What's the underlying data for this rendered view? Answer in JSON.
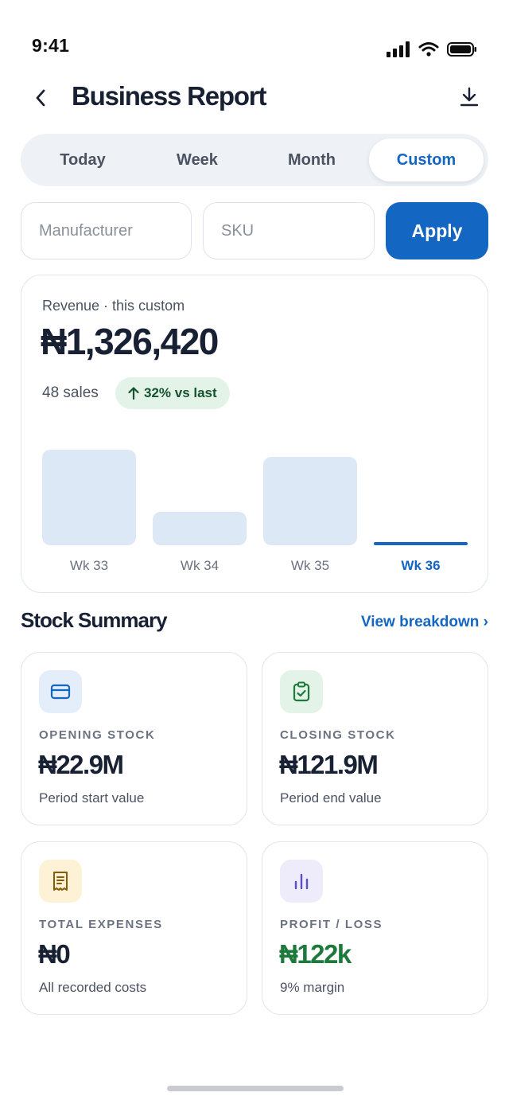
{
  "status_bar": {
    "time": "9:41"
  },
  "header": {
    "title": "Business Report"
  },
  "tabs": [
    {
      "label": "Today",
      "active": false
    },
    {
      "label": "Week",
      "active": false
    },
    {
      "label": "Month",
      "active": false
    },
    {
      "label": "Custom",
      "active": true
    }
  ],
  "filters": {
    "manufacturer_placeholder": "Manufacturer",
    "manufacturer_value": "",
    "sku_placeholder": "SKU",
    "sku_value": "",
    "apply_label": "Apply"
  },
  "revenue": {
    "label": "Revenue · this custom",
    "amount": "₦1,326,420",
    "sales": "48 sales",
    "growth": "32% vs last"
  },
  "chart_data": {
    "type": "bar",
    "categories": [
      "Wk 33",
      "Wk 34",
      "Wk 35",
      "Wk 36"
    ],
    "values": [
      0.91,
      0.32,
      0.84,
      0.03
    ],
    "highlight": "Wk 36",
    "colors": {
      "bar": "#dde8f6",
      "highlight": "#1466c3"
    },
    "title": "",
    "xlabel": "",
    "ylabel": "",
    "ylim": [
      0,
      1
    ]
  },
  "stock_summary": {
    "title": "Stock Summary",
    "view_breakdown": "View breakdown ›",
    "cards": [
      {
        "label": "OPENING STOCK",
        "value": "₦22.9M",
        "sub": "Period start value",
        "icon": "wallet-icon",
        "icon_bg": "#e4eefa",
        "icon_color": "#1466c3",
        "value_color": "#182033"
      },
      {
        "label": "CLOSING STOCK",
        "value": "₦121.9M",
        "sub": "Period end value",
        "icon": "clipboard-check-icon",
        "icon_bg": "#e3f3e8",
        "icon_color": "#1e7a3c",
        "value_color": "#182033"
      },
      {
        "label": "TOTAL EXPENSES",
        "value": "₦0",
        "sub": "All recorded costs",
        "icon": "receipt-icon",
        "icon_bg": "#fdf1d6",
        "icon_color": "#8a5a0b",
        "value_color": "#182033"
      },
      {
        "label": "PROFIT / LOSS",
        "value": "₦122k",
        "sub": "9% margin",
        "icon": "bar-chart-icon",
        "icon_bg": "#eeebfb",
        "icon_color": "#5b4fc6",
        "value_color": "#1e7a3c"
      }
    ]
  }
}
